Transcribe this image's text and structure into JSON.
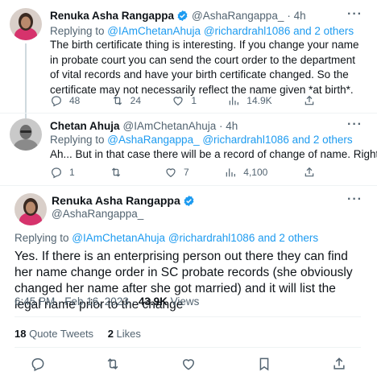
{
  "tweets": [
    {
      "name": "Renuka Asha Rangappa",
      "handle": "@AshaRangappa_",
      "time": "· 4h",
      "replying_prefix": "Replying to ",
      "replying_to": "@IAmChetanAhuja @richardrahl1086 and 2 others",
      "text": "The birth certificate thing is interesting. If you change your name in probate court you can send the court order to the department of vital records and have your birth certificate changed. So the certificate may not necessarily reflect the name given *at birth*.",
      "replies": "48",
      "retweets": "24",
      "likes": "1",
      "views": "14.9K",
      "more": "···"
    },
    {
      "name": "Chetan Ahuja",
      "handle": "@IAmChetanAhuja · 4h",
      "replying_prefix": "Replying to ",
      "replying_to": "@AshaRangappa_ @richardrahl1086 and 2 others",
      "text": "Ah... But in that case there will be a record of change of name. Right?",
      "replies": "1",
      "retweets": "",
      "likes": "7",
      "views": "4,100",
      "more": "···"
    }
  ],
  "main": {
    "name": "Renuka Asha Rangappa",
    "handle": "@AshaRangappa_",
    "more": "···",
    "replying_prefix": "Replying to ",
    "replying_to": "@IAmChetanAhuja @richardrahl1086 and 2 others",
    "text": "Yes. If there is an enterprising person out there they can find her name change order in SC probate records (she obviously changed her name after she got married) and it will list the legal name prior to the change",
    "timestamp": "6:45 PM · Feb 16, 2023 · ",
    "views_count": "43.9K",
    "views_label": " Views",
    "quote_count": "18",
    "quote_label": " Quote Tweets",
    "likes_count": "2",
    "likes_label": " Likes"
  },
  "colors": {
    "link": "#1d9bf0",
    "verified": "#1d9bf0",
    "muted": "#536471"
  }
}
